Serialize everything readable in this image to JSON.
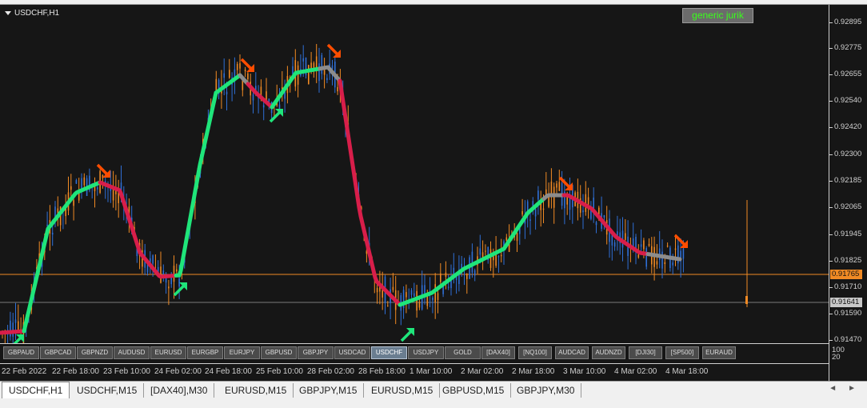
{
  "window": {
    "title": "USDCHF,H1"
  },
  "indicator": {
    "label": "generic jurik",
    "text_color": "#39ff1a"
  },
  "price_axis": {
    "labels": [
      "0.92895",
      "0.92775",
      "0.92655",
      "0.92540",
      "0.92420",
      "0.92300",
      "0.92185",
      "0.92065",
      "0.91945",
      "0.91825",
      "0.91710",
      "0.91590",
      "0.91470"
    ],
    "bid_tag": "0.91765",
    "last_tag": "0.91641",
    "bid_color": "#f08a24"
  },
  "subwindow_scale": {
    "max": "100",
    "min": "20"
  },
  "symbol_buttons": [
    "GBPAUD",
    "GBPCAD",
    "GBPNZD",
    "AUDUSD",
    "EURUSD",
    "EURGBP",
    "EURJPY",
    "GBPUSD",
    "GBPJPY",
    "USDCAD",
    "USDCHF",
    "USDJPY",
    "GOLD",
    "[DAX40]",
    "[NQ100]",
    "AUDCAD",
    "AUDNZD",
    "[DJI30]",
    "[SP500]",
    "EURAUD"
  ],
  "active_symbol": "USDCHF",
  "time_axis": [
    "22 Feb 2022",
    "22 Feb 18:00",
    "23 Feb 10:00",
    "24 Feb 02:00",
    "24 Feb 18:00",
    "25 Feb 10:00",
    "28 Feb 02:00",
    "28 Feb 18:00",
    "1 Mar 10:00",
    "2 Mar 02:00",
    "2 Mar 18:00",
    "3 Mar 10:00",
    "4 Mar 02:00",
    "4 Mar 18:00"
  ],
  "tabs": [
    "USDCHF,H1",
    "USDCHF,M15",
    "[DAX40],M30",
    "EURUSD,M15",
    "GBPJPY,M15",
    "EURUSD,M15",
    "GBPUSD,M15",
    "GBPJPY,M30"
  ],
  "active_tab": 0,
  "tab_nav": {
    "left": "◄",
    "right": "►"
  },
  "colors": {
    "background": "#161616",
    "bull_candle": "#2f6fd6",
    "bear_candle": "#f08a24",
    "jurik_up": "#1fe57a",
    "jurik_down": "#d81e4a",
    "jurik_flat": "#8c8c8c",
    "arrow_buy": "#1fe57a",
    "arrow_sell": "#ff4d00"
  }
}
